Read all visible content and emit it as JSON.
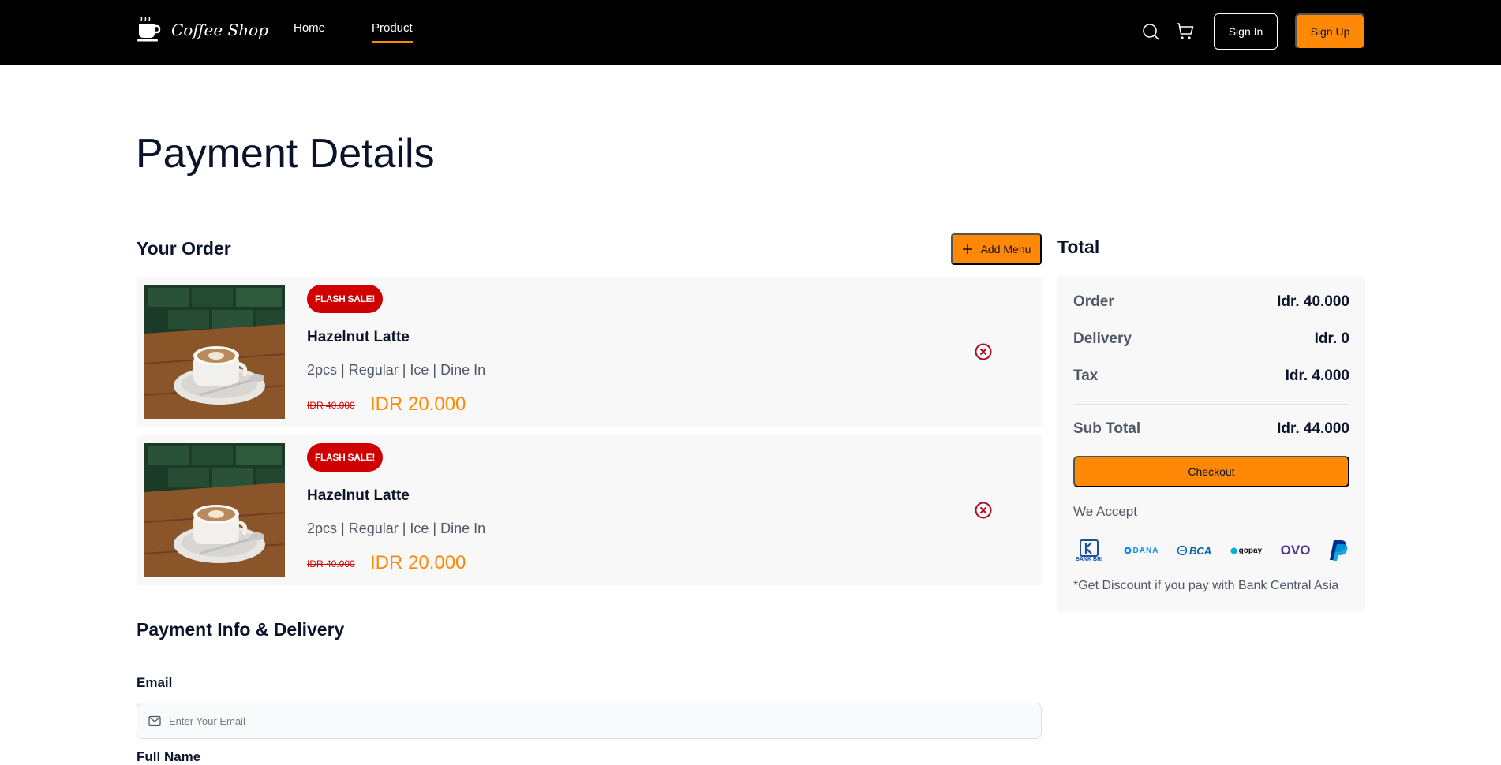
{
  "nav": {
    "brand": "Coffee Shop",
    "links": [
      {
        "label": "Home",
        "active": false
      },
      {
        "label": "Product",
        "active": true
      }
    ],
    "icons": [
      "search-icon",
      "cart-icon"
    ],
    "sign_in": "Sign In",
    "sign_up": "Sign Up"
  },
  "page_title": "Payment Details",
  "order": {
    "title": "Your Order",
    "add_menu": "Add Menu",
    "items": [
      {
        "badge": "FLASH SALE!",
        "name": "Hazelnut Latte",
        "detail": "2pcs | Regular | Ice | Dine In",
        "old_price": "IDR 40.000",
        "price": "IDR 20.000"
      },
      {
        "badge": "FLASH SALE!",
        "name": "Hazelnut Latte",
        "detail": "2pcs | Regular | Ice | Dine In",
        "old_price": "IDR 40.000",
        "price": "IDR 20.000"
      }
    ]
  },
  "payment": {
    "title": "Payment Info & Delivery",
    "email_label": "Email",
    "email_placeholder": "Enter Your Email",
    "fullname_label": "Full Name"
  },
  "total": {
    "title": "Total",
    "rows": [
      {
        "label": "Order",
        "value": "Idr. 40.000"
      },
      {
        "label": "Delivery",
        "value": "Idr. 0"
      },
      {
        "label": "Tax",
        "value": "Idr. 4.000"
      }
    ],
    "subtotal_label": "Sub Total",
    "subtotal_value": "Idr. 44.000",
    "checkout": "Checkout",
    "we_accept": "We Accept",
    "logos": [
      "BANK BRI",
      "DANA",
      "BCA",
      "gopay",
      "OVO",
      "PayPal"
    ],
    "discount_note": "*Get Discount if you pay with Bank Central Asia"
  },
  "colors": {
    "accent": "#ff8906",
    "navbar": "#000000",
    "flash_badge": "#d00000",
    "remove": "#b0071f"
  }
}
